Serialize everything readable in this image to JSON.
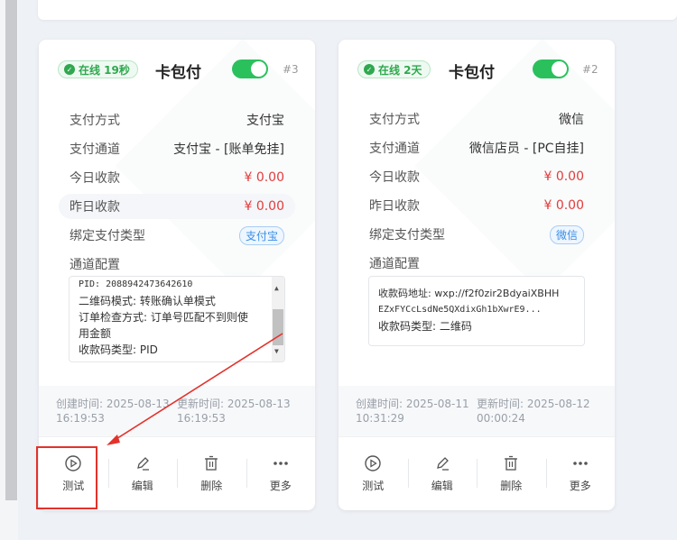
{
  "cards": [
    {
      "status": "在线 19秒",
      "title": "卡包付",
      "number": "#3",
      "rows": [
        {
          "label": "支付方式",
          "value": "支付宝"
        },
        {
          "label": "支付通道",
          "value": "支付宝 - [账单免挂]"
        },
        {
          "label": "今日收款",
          "value": "¥ 0.00"
        },
        {
          "label": "昨日收款",
          "value": "¥ 0.00"
        },
        {
          "label": "绑定支付类型",
          "value": "支付宝"
        },
        {
          "label": "通道配置"
        }
      ],
      "config_lines": [
        "PID: 2088942473642610",
        "二维码模式: 转账确认单模式",
        "订单检查方式: 订单号匹配不到则使",
        "用金额",
        "收款码类型: PID"
      ],
      "created": "创建时间: 2025-08-13 16:19:53",
      "created_l1": "创建时间: 2025-08-13",
      "created_l2": "16:19:53",
      "updated_l1": "更新时间: 2025-08-13",
      "updated_l2": "16:19:53"
    },
    {
      "status": "在线 2天",
      "title": "卡包付",
      "number": "#2",
      "rows": [
        {
          "label": "支付方式",
          "value": "微信"
        },
        {
          "label": "支付通道",
          "value": "微信店员 - [PC自挂]"
        },
        {
          "label": "今日收款",
          "value": "¥ 0.00"
        },
        {
          "label": "昨日收款",
          "value": "¥ 0.00"
        },
        {
          "label": "绑定支付类型",
          "value": "微信"
        },
        {
          "label": "通道配置"
        }
      ],
      "config_lines": [
        "收款码地址: wxp://f2f0zir2BdyaiXBHH",
        "EZxFYCcLsdNe5QXdixGh1bXwrE9...",
        "收款码类型: 二维码"
      ],
      "created_l1": "创建时间: 2025-08-11",
      "created_l2": "10:31:29",
      "updated_l1": "更新时间: 2025-08-12",
      "updated_l2": "00:00:24"
    }
  ],
  "actions": {
    "test": "测试",
    "edit": "编辑",
    "delete": "删除",
    "more": "更多"
  },
  "colors": {
    "accent_green": "#2ac15d",
    "money_red": "#e23c3c",
    "annotation_red": "#e3322b",
    "tag_blue": "#3a8ee6"
  }
}
